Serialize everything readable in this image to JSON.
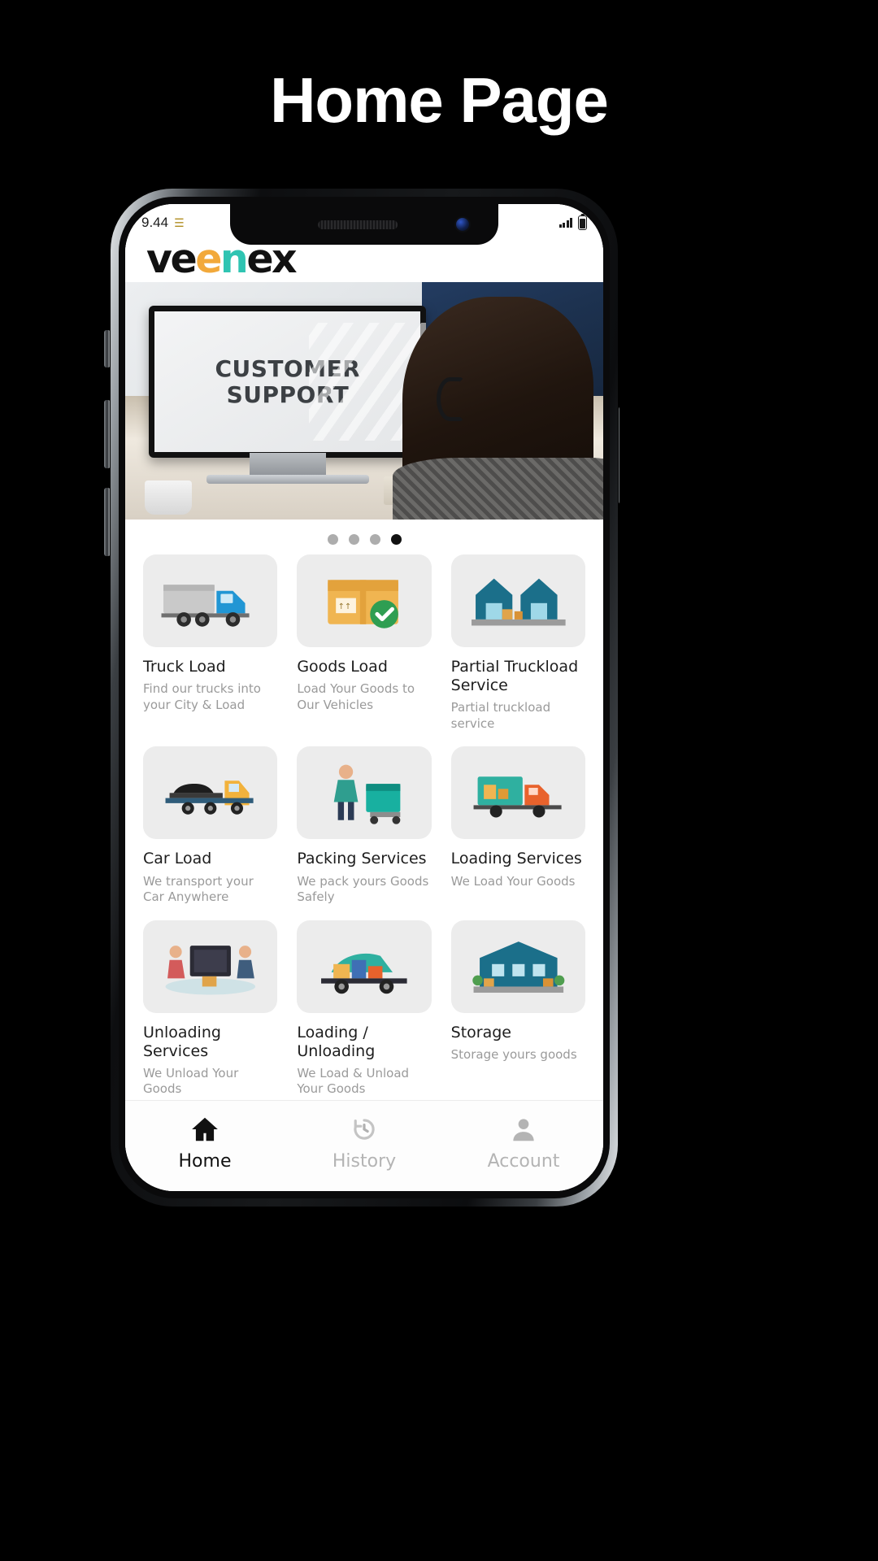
{
  "headline": "Home Page",
  "status_bar": {
    "time": "9.44",
    "wifi_icon": "wifi-icon",
    "signal_icon": "signal-bars-icon",
    "battery_icon": "battery-icon",
    "battery_level": "80%"
  },
  "app_bar": {
    "logo_parts": [
      {
        "text": "ve",
        "color": "#111111"
      },
      {
        "text": "e",
        "color": "#f2a93b"
      },
      {
        "text": "n",
        "color": "#2fc4b2"
      },
      {
        "text": "ex",
        "color": "#111111"
      }
    ],
    "logo_full": "veenex"
  },
  "banner": {
    "name": "promo-carousel",
    "headline_line1": "CUSTOMER",
    "headline_line2": "SUPPORT",
    "alt": "customer support agent with headset at computer"
  },
  "carousel": {
    "total": 4,
    "active_index": 3,
    "dot_color": "#adadad",
    "active_dot_color": "#111111"
  },
  "services": [
    {
      "title": "Truck Load",
      "subtitle": "Find our trucks into your City & Load",
      "icon": "truck-icon"
    },
    {
      "title": "Goods Load",
      "subtitle": "Load Your Goods to Our Vehicles",
      "icon": "box-check-icon"
    },
    {
      "title": "Partial Truckload Service",
      "subtitle": "Partial truckload service",
      "icon": "warehouse-icon"
    },
    {
      "title": "Car Load",
      "subtitle": "We transport your Car Anywhere",
      "icon": "car-carrier-icon"
    },
    {
      "title": "Packing Services",
      "subtitle": "We pack yours Goods Safely",
      "icon": "packing-worker-icon"
    },
    {
      "title": "Loading Services",
      "subtitle": "We Load Your Goods",
      "icon": "loading-truck-icon"
    },
    {
      "title": "Unloading Services",
      "subtitle": "We Unload Your Goods",
      "icon": "unloading-workers-icon"
    },
    {
      "title": "Loading / Unloading",
      "subtitle": "We Load & Unload Your Goods",
      "icon": "load-unload-truck-icon"
    },
    {
      "title": "Storage",
      "subtitle": "Storage yours goods",
      "icon": "storage-building-icon"
    },
    {
      "title": "",
      "subtitle": "",
      "icon": "partial-row-icon-1"
    },
    {
      "title": "",
      "subtitle": "",
      "icon": "partial-row-icon-2"
    },
    {
      "title": "",
      "subtitle": "",
      "icon": "partial-row-icon-3"
    }
  ],
  "bottom_nav": {
    "items": [
      {
        "label": "Home",
        "icon": "home-icon",
        "active": true
      },
      {
        "label": "History",
        "icon": "history-clock-icon",
        "active": false
      },
      {
        "label": "Account",
        "icon": "person-icon",
        "active": false
      }
    ],
    "active_color": "#111111",
    "inactive_color": "#b4b4b4"
  }
}
